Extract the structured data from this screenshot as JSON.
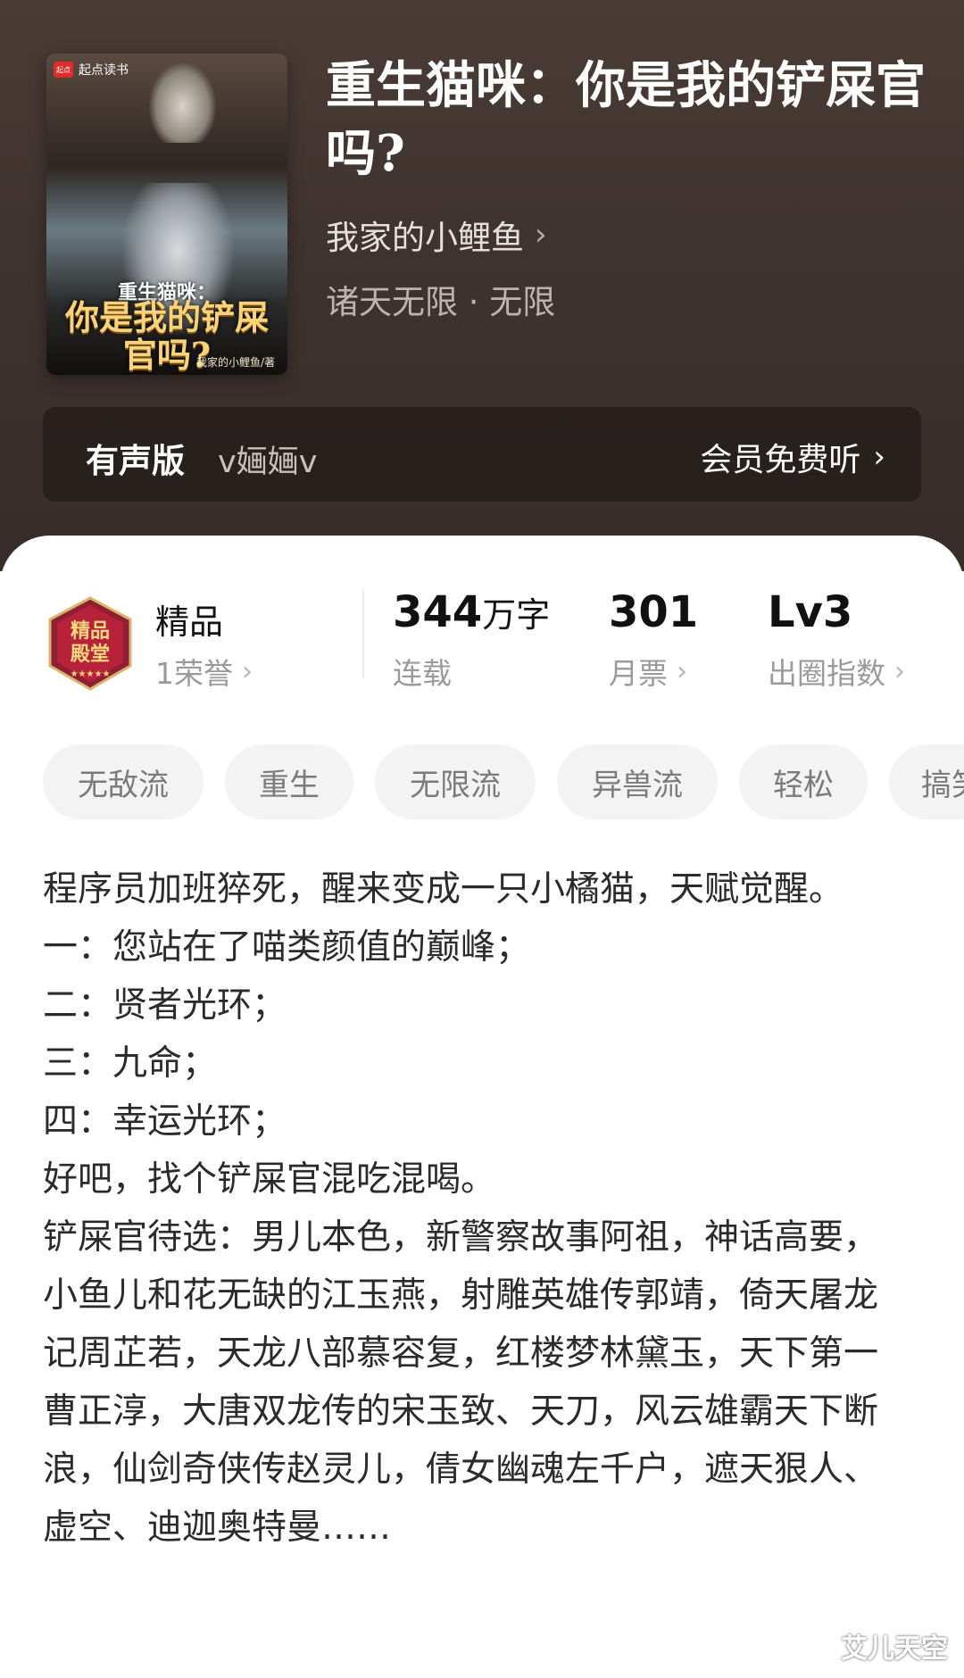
{
  "book": {
    "title": "重生猫咪：你是我的铲屎官吗?",
    "author": "我家的小鲤鱼",
    "genre": "诸天无限 · 无限",
    "cover": {
      "brand": "起点读书",
      "brand_logo": "起点",
      "title_line1": "重生猫咪：",
      "title_line2": "你是我的铲屎官吗?",
      "author": "我家的小鲤鱼/著"
    }
  },
  "audio": {
    "label": "有声版",
    "narrator": "v婳婳v",
    "action": "会员免费听"
  },
  "stats": {
    "badge_title": "精品",
    "badge_sub": "1荣誉",
    "badge_text": "精品\n殿堂",
    "words_value": "344",
    "words_unit": "万字",
    "words_sub": "连载",
    "votes_value": "301",
    "votes_sub": "月票",
    "level_value": "Lv3",
    "level_sub": "出圈指数"
  },
  "tags": [
    "无敌流",
    "重生",
    "无限流",
    "异兽流",
    "轻松",
    "搞笑"
  ],
  "synopsis": [
    "程序员加班猝死，醒来变成一只小橘猫，天赋觉醒。",
    "一：您站在了喵类颜值的巅峰；",
    "二：贤者光环；",
    "三：九命；",
    "四：幸运光环；",
    "好吧，找个铲屎官混吃混喝。",
    "铲屎官待选：男儿本色，新警察故事阿祖，神话高要，小鱼儿和花无缺的江玉燕，射雕英雄传郭靖，倚天屠龙记周芷若，天龙八部慕容复，红楼梦林黛玉，天下第一曹正淳，大唐双龙传的宋玉致、天刀，风云雄霸天下断浪，仙剑奇侠传赵灵儿，倩女幽魂左千户，遮天狠人、虚空、迪迦奥特曼……"
  ],
  "watermark": "艾儿天空",
  "icons": {
    "chevron": "chevron-right-icon"
  },
  "colors": {
    "header_bg": "#3f332f",
    "tag_bg": "#f3f3f3",
    "badge_red": "#b8213a"
  }
}
